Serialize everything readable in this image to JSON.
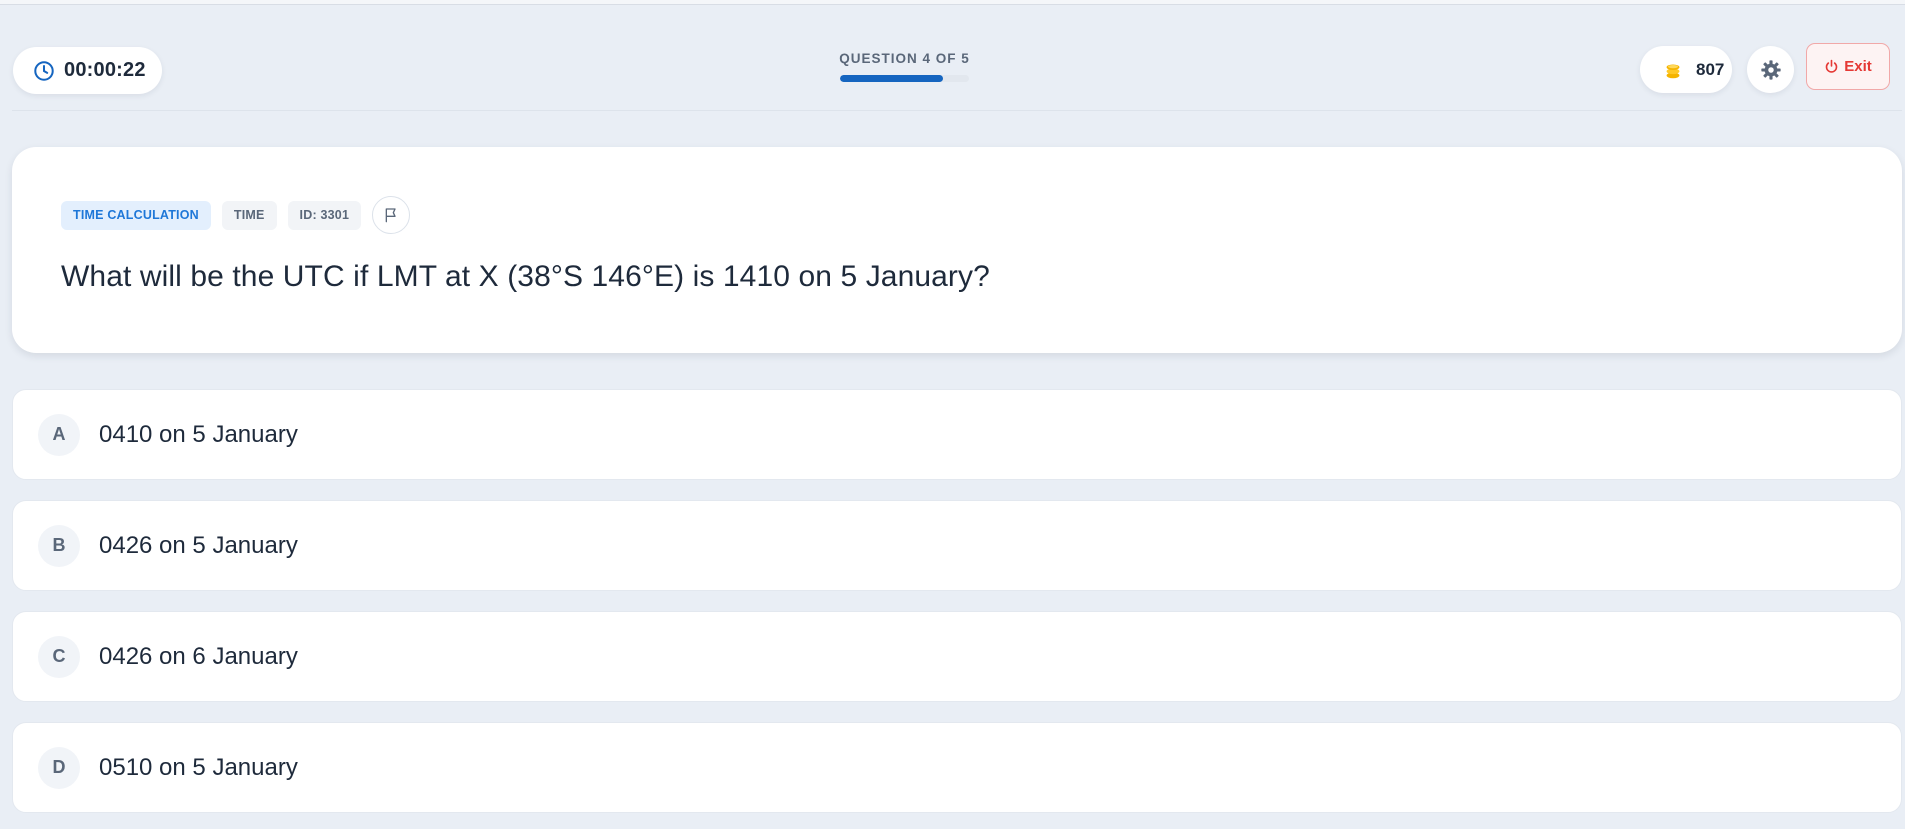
{
  "header": {
    "timer": "00:00:22",
    "progress": {
      "label": "QUESTION 4 OF 5",
      "current": 4,
      "total": 5,
      "fill_percent": 80
    },
    "coins": "807",
    "exit_label": "Exit"
  },
  "question": {
    "tags": [
      "TIME CALCULATION",
      "TIME",
      "ID: 3301"
    ],
    "text": "What will be the UTC if LMT at X (38°S 146°E) is 1410 on 5 January?"
  },
  "options": [
    {
      "letter": "A",
      "text": "0410 on 5 January"
    },
    {
      "letter": "B",
      "text": "0426 on 5 January"
    },
    {
      "letter": "C",
      "text": "0426 on 6 January"
    },
    {
      "letter": "D",
      "text": "0510 on 5 January"
    }
  ],
  "icons": {
    "timer": "clock-icon",
    "coins": "coins-icon",
    "settings": "gear-icon",
    "exit": "power-icon",
    "flag": "flag-icon"
  },
  "colors": {
    "accent": "#1565c0",
    "danger": "#e53935",
    "coin": "#f5b400",
    "background": "#e9eef5"
  }
}
